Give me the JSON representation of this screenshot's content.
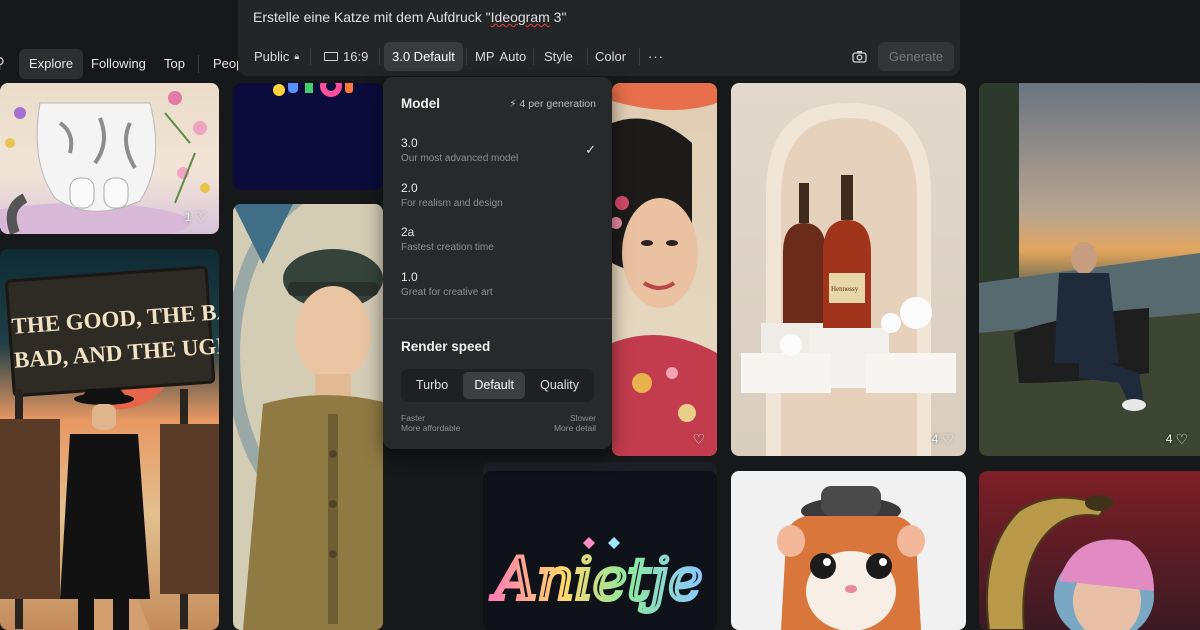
{
  "prompt": {
    "text_before": "Erstelle eine Katze mit dem Aufdruck \"",
    "text_spell": "Ideogram",
    "text_after": " 3\""
  },
  "toolbar": {
    "visibility": "Public",
    "aspect": "16:9",
    "model": "3.0 Default",
    "magic_prompt": "MP",
    "magic_prompt_value": "Auto",
    "style": "Style",
    "color": "Color",
    "more": "···",
    "generate": "Generate"
  },
  "nav": {
    "tabs": [
      {
        "label": "Explore",
        "active": true
      },
      {
        "label": "Following",
        "active": false
      },
      {
        "label": "Top",
        "active": false
      },
      {
        "label": "Peop",
        "active": false
      }
    ]
  },
  "model_menu": {
    "title": "Model",
    "cost": "4 per generation",
    "models": [
      {
        "version": "3.0",
        "desc": "Our most advanced model",
        "selected": true
      },
      {
        "version": "2.0",
        "desc": "For realism and design",
        "selected": false
      },
      {
        "version": "2a",
        "desc": "Fastest creation time",
        "selected": false
      },
      {
        "version": "1.0",
        "desc": "Great for creative art",
        "selected": false
      }
    ],
    "render_title": "Render speed",
    "speeds": [
      "Turbo",
      "Default",
      "Quality"
    ],
    "selected_speed": "Default",
    "left_note": [
      "Faster",
      "More affordable"
    ],
    "right_note": [
      "Slower",
      "More detail"
    ]
  },
  "gallery": {
    "likes": {
      "cat": "1",
      "bottle": "4",
      "lake": "4"
    },
    "western_title_lines": [
      "THE GOOD, THE BAD,",
      "BAD, AND THE UGLY"
    ],
    "script_word": "Anietje",
    "bottle_label": "Hennessy"
  },
  "colors": {
    "accent": "#3a3b3e",
    "background": "#171819",
    "panel": "#242527"
  }
}
